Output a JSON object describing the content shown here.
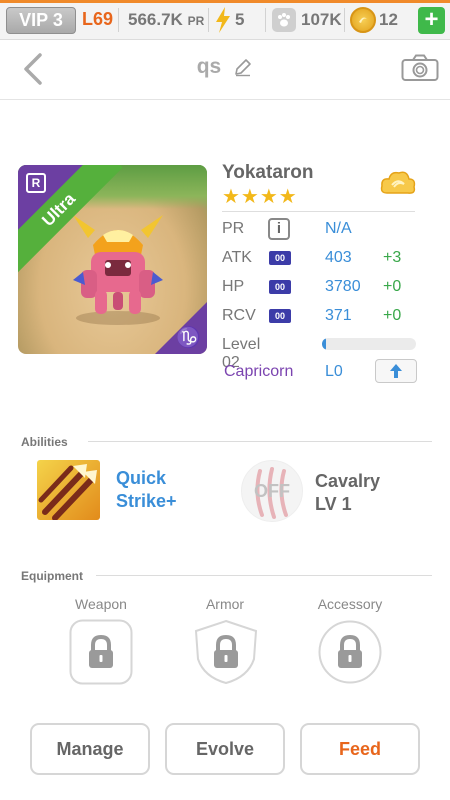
{
  "topbar": {
    "vip": "VIP 3",
    "level": "L69",
    "power": "566.7K",
    "power_unit": "PR",
    "energy": "5",
    "paws": "107K",
    "coins": "12",
    "add_label": "+"
  },
  "header": {
    "title": "qs"
  },
  "monster": {
    "rarity_badge": "R",
    "rarity": "Ultra",
    "sign_glyph": "♑",
    "name": "Yokataron",
    "stars": "★★★★",
    "stats": [
      {
        "label": "PR",
        "value": "N/A",
        "bonus": ""
      },
      {
        "label": "ATK",
        "chip": "00",
        "value": "403",
        "bonus": "+3"
      },
      {
        "label": "HP",
        "chip": "00",
        "value": "3780",
        "bonus": "+0"
      },
      {
        "label": "RCV",
        "chip": "00",
        "value": "371",
        "bonus": "+0"
      }
    ],
    "level": "Level 02",
    "xp_fraction": 0.02,
    "zodiac": "Capricorn",
    "zodiac_level": "L0"
  },
  "abilities": {
    "label": "Abilities",
    "items": [
      {
        "name_line1": "Quick",
        "name_line2": "Strike+"
      },
      {
        "state": "OFF",
        "name_line1": "Cavalry",
        "name_line2": "LV 1"
      }
    ]
  },
  "equipment": {
    "label": "Equipment",
    "slots": [
      "Weapon",
      "Armor",
      "Accessory"
    ]
  },
  "actions": {
    "manage": "Manage",
    "evolve": "Evolve",
    "feed": "Feed"
  },
  "colors": {
    "accent_blue": "#3a8ed8",
    "bonus_green": "#3aa84b",
    "feed_orange": "#e8661c",
    "zodiac_purple": "#7b44b0"
  }
}
